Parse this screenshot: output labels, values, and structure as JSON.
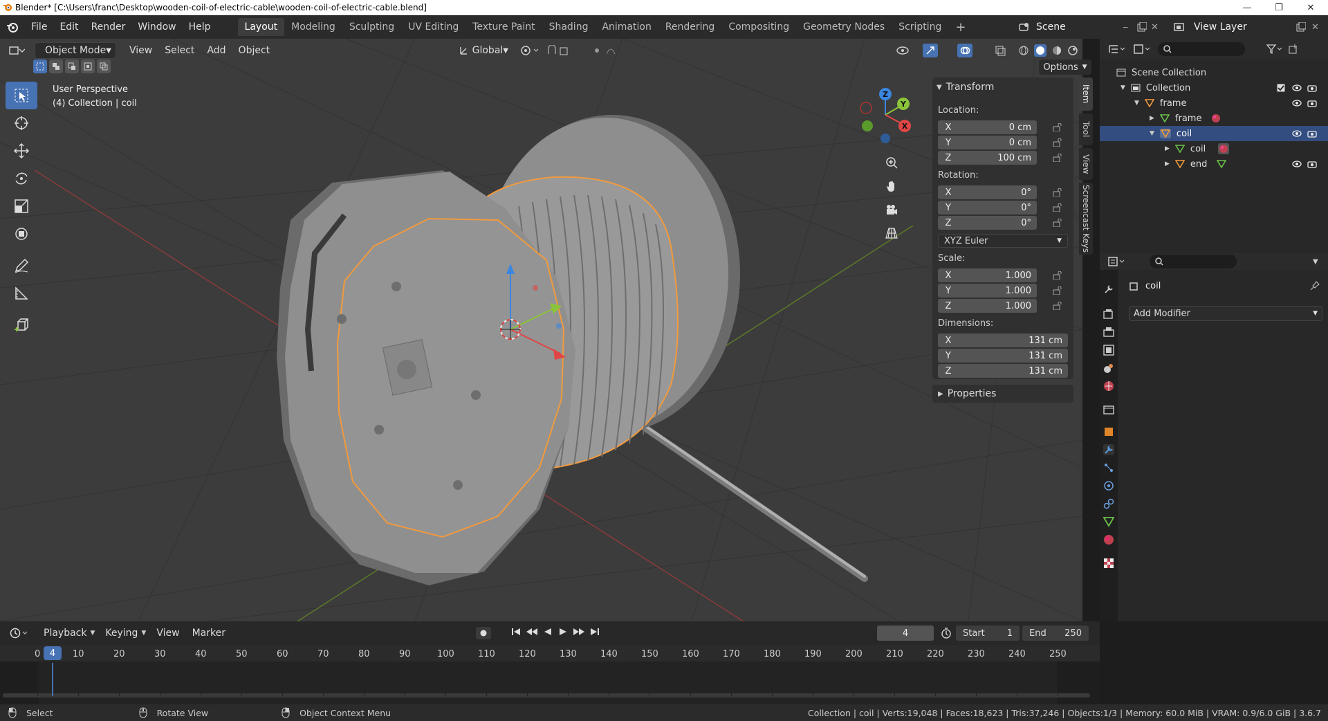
{
  "window": {
    "title": "Blender* [C:\\Users\\franc\\Desktop\\wooden-coil-of-electric-cable\\wooden-coil-of-electric-cable.blend]",
    "controls": [
      "minimize",
      "restore",
      "close"
    ]
  },
  "menubar": {
    "items": [
      "File",
      "Edit",
      "Render",
      "Window",
      "Help"
    ]
  },
  "workspaces": [
    "Layout",
    "Modeling",
    "Sculpting",
    "UV Editing",
    "Texture Paint",
    "Shading",
    "Animation",
    "Rendering",
    "Compositing",
    "Geometry Nodes",
    "Scripting"
  ],
  "active_workspace": "Layout",
  "scene": {
    "name": "Scene",
    "view_layer": "View Layer"
  },
  "viewport_header": {
    "mode": "Object Mode",
    "menus": [
      "View",
      "Select",
      "Add",
      "Object"
    ],
    "orientation": "Global",
    "options_label": "Options"
  },
  "viewport": {
    "perspective": "User Perspective",
    "context": "(4) Collection | coil"
  },
  "gizmo": {
    "x": "X",
    "y": "Y",
    "z": "Z"
  },
  "npanel": {
    "tabs": [
      "Item",
      "Tool",
      "View",
      "Screencast Keys"
    ],
    "transform_title": "Transform",
    "location_label": "Location:",
    "location": [
      {
        "axis": "X",
        "value": "0 cm"
      },
      {
        "axis": "Y",
        "value": "0 cm"
      },
      {
        "axis": "Z",
        "value": "100 cm"
      }
    ],
    "rotation_label": "Rotation:",
    "rotation": [
      {
        "axis": "X",
        "value": "0°"
      },
      {
        "axis": "Y",
        "value": "0°"
      },
      {
        "axis": "Z",
        "value": "0°"
      }
    ],
    "rotation_mode": "XYZ Euler",
    "scale_label": "Scale:",
    "scale": [
      {
        "axis": "X",
        "value": "1.000"
      },
      {
        "axis": "Y",
        "value": "1.000"
      },
      {
        "axis": "Z",
        "value": "1.000"
      }
    ],
    "dimensions_label": "Dimensions:",
    "dimensions": [
      {
        "axis": "X",
        "value": "131 cm"
      },
      {
        "axis": "Y",
        "value": "131 cm"
      },
      {
        "axis": "Z",
        "value": "131 cm"
      }
    ],
    "properties_title": "Properties"
  },
  "outliner": {
    "rows": [
      {
        "label": "Scene Collection",
        "kind": "scene-collection"
      },
      {
        "label": "Collection",
        "kind": "collection"
      },
      {
        "label": "frame",
        "kind": "object"
      },
      {
        "label": "frame",
        "kind": "mesh"
      },
      {
        "label": "coil",
        "kind": "object",
        "selected": true
      },
      {
        "label": "coil",
        "kind": "mesh"
      },
      {
        "label": "end",
        "kind": "object"
      }
    ]
  },
  "properties": {
    "object_name": "coil",
    "add_modifier": "Add Modifier"
  },
  "timeline": {
    "menus": [
      "Playback",
      "Keying",
      "View",
      "Marker"
    ],
    "current_frame": "4",
    "start_label": "Start",
    "start": "1",
    "end_label": "End",
    "end": "250",
    "ticks": [
      "0",
      "10",
      "20",
      "30",
      "40",
      "50",
      "60",
      "70",
      "80",
      "90",
      "100",
      "110",
      "120",
      "130",
      "140",
      "150",
      "160",
      "170",
      "180",
      "190",
      "200",
      "210",
      "220",
      "230",
      "240",
      "250"
    ]
  },
  "statusbar": {
    "select": "Select",
    "rotate": "Rotate View",
    "context_menu": "Object Context Menu",
    "stats": "Collection | coil | Verts:19,048 | Faces:18,623 | Tris:37,246 | Objects:1/3 | Memory: 60.0 MiB | VRAM: 0.9/6.0 GiB | 3.6.7"
  },
  "colors": {
    "accent": "#4772b3",
    "selection_outline": "#f29a3d",
    "axis_x": "#e04646",
    "axis_y": "#8bc43a",
    "axis_z": "#3b87e0",
    "viewport_bg": "#3c3c3c"
  }
}
